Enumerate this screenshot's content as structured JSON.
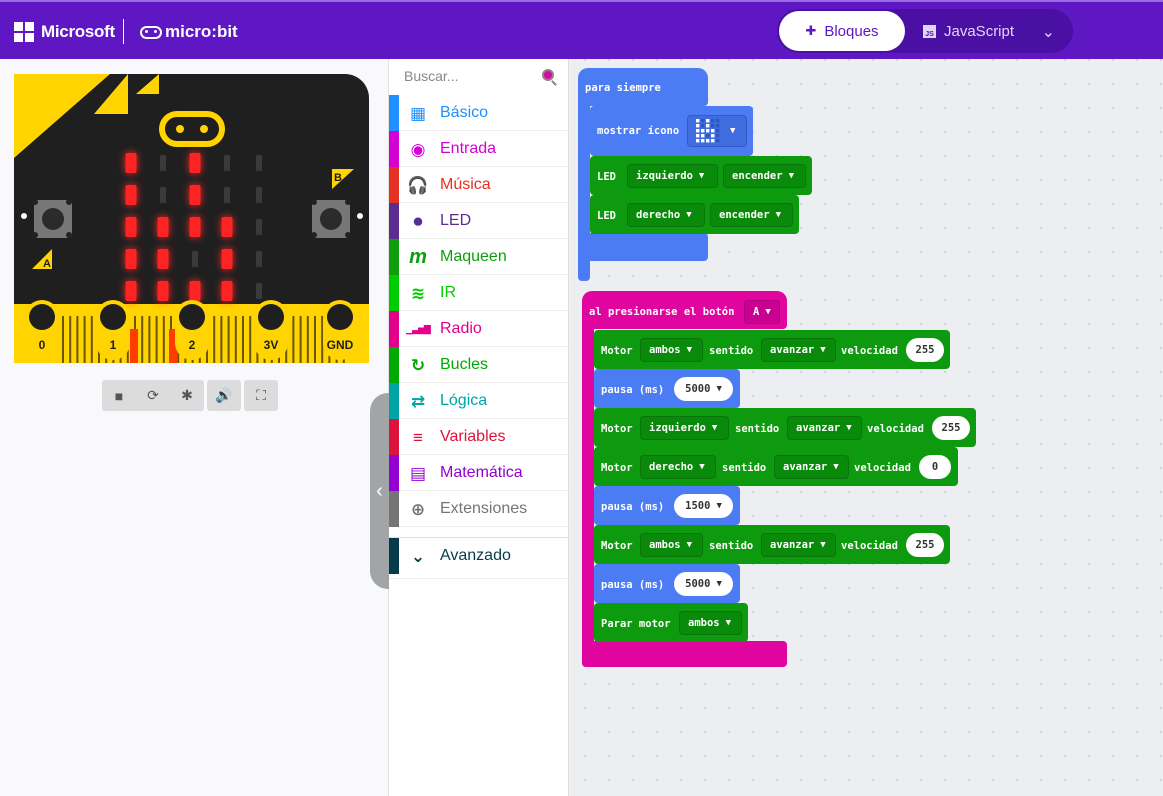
{
  "header": {
    "brand": "Microsoft",
    "product": "micro:bit",
    "tabs": [
      {
        "label": "Bloques",
        "icon": "puzzle-icon",
        "active": true
      },
      {
        "label": "JavaScript",
        "icon": "js-icon",
        "active": false
      }
    ],
    "colors": {
      "accent": "#5e17c2"
    }
  },
  "simulator": {
    "pins": [
      "0",
      "1",
      "2",
      "3V",
      "GND"
    ],
    "buttons": [
      "A",
      "B"
    ],
    "led_matrix": [
      [
        1,
        0,
        1,
        0,
        0
      ],
      [
        1,
        0,
        1,
        0,
        0
      ],
      [
        1,
        1,
        1,
        1,
        0
      ],
      [
        1,
        1,
        0,
        1,
        0
      ],
      [
        1,
        1,
        1,
        1,
        0
      ]
    ],
    "toolbar_icons": [
      "stop-icon",
      "restart-icon",
      "debug-icon",
      "sound-icon",
      "fullscreen-icon"
    ]
  },
  "toolbox": {
    "search_placeholder": "Buscar...",
    "categories": [
      {
        "label": "Básico",
        "color": "#1e90ff",
        "icon": "grid-icon",
        "glyph": "▦"
      },
      {
        "label": "Entrada",
        "color": "#d400d4",
        "icon": "input-icon",
        "glyph": "◉"
      },
      {
        "label": "Música",
        "color": "#e63022",
        "icon": "headphones-icon",
        "glyph": "🎧"
      },
      {
        "label": "LED",
        "color": "#5c2d91",
        "icon": "toggle-icon",
        "glyph": "⏺"
      },
      {
        "label": "Maqueen",
        "color": "#0f9d0f",
        "icon": "m-icon",
        "glyph": "m"
      },
      {
        "label": "IR",
        "color": "#00cc00",
        "icon": "wifi-icon",
        "glyph": "≋"
      },
      {
        "label": "Radio",
        "color": "#e3008c",
        "icon": "signal-icon",
        "glyph": "▁▃▅▇"
      },
      {
        "label": "Bucles",
        "color": "#00aa00",
        "icon": "loop-icon",
        "glyph": "↻"
      },
      {
        "label": "Lógica",
        "color": "#00a4a6",
        "icon": "shuffle-icon",
        "glyph": "⇄"
      },
      {
        "label": "Variables",
        "color": "#dc143c",
        "icon": "list-icon",
        "glyph": "≡"
      },
      {
        "label": "Matemática",
        "color": "#9400d3",
        "icon": "calculator-icon",
        "glyph": "▤"
      },
      {
        "label": "Extensiones",
        "color": "#757575",
        "icon": "plus-icon",
        "glyph": "⊕"
      }
    ],
    "advanced": {
      "label": "Avanzado",
      "color": "#073b4c",
      "icon": "chevron-down-icon",
      "glyph": "⌄"
    }
  },
  "workspace": {
    "forever": {
      "title": "para siempre",
      "show_icon_label": "mostrar ícono",
      "led_rows": [
        {
          "label": "LED",
          "side": "izquierdo",
          "state": "encender"
        },
        {
          "label": "LED",
          "side": "derecho",
          "state": "encender"
        }
      ]
    },
    "on_button": {
      "title": "al presionarse el botón",
      "button": "A",
      "statements": [
        {
          "type": "motor",
          "label": "Motor",
          "motor": "ambos",
          "dir_label": "sentido",
          "dir": "avanzar",
          "speed_label": "velocidad",
          "speed": "255"
        },
        {
          "type": "pause",
          "label": "pausa (ms)",
          "value": "5000"
        },
        {
          "type": "motor",
          "label": "Motor",
          "motor": "izquierdo",
          "dir_label": "sentido",
          "dir": "avanzar",
          "speed_label": "velocidad",
          "speed": "255"
        },
        {
          "type": "motor",
          "label": "Motor",
          "motor": "derecho",
          "dir_label": "sentido",
          "dir": "avanzar",
          "speed_label": "velocidad",
          "speed": "0"
        },
        {
          "type": "pause",
          "label": "pausa (ms)",
          "value": "1500"
        },
        {
          "type": "motor",
          "label": "Motor",
          "motor": "ambos",
          "dir_label": "sentido",
          "dir": "avanzar",
          "speed_label": "velocidad",
          "speed": "255"
        },
        {
          "type": "pause",
          "label": "pausa (ms)",
          "value": "5000"
        },
        {
          "type": "stop",
          "label": "Parar motor",
          "motor": "ambos"
        }
      ]
    }
  }
}
